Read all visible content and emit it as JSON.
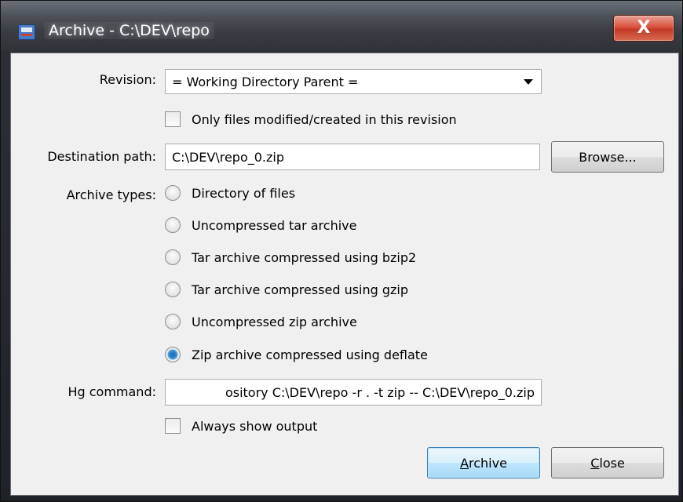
{
  "window": {
    "title": "Archive - C:\\DEV\\repo",
    "close_glyph": "X"
  },
  "form": {
    "revision_label": "Revision:",
    "revision_value": "= Working Directory Parent =",
    "only_modified_label": "Only files modified/created in this revision",
    "only_modified_checked": false,
    "destination_label": "Destination path:",
    "destination_value": "C:\\DEV\\repo_0.zip",
    "browse_label": "Browse...",
    "archive_types_label": "Archive types:",
    "archive_types": [
      {
        "label": "Directory of files",
        "checked": false
      },
      {
        "label": "Uncompressed tar archive",
        "checked": false
      },
      {
        "label": "Tar archive compressed using bzip2",
        "checked": false
      },
      {
        "label": "Tar archive compressed using gzip",
        "checked": false
      },
      {
        "label": "Uncompressed zip archive",
        "checked": false
      },
      {
        "label": "Zip archive compressed using deflate",
        "checked": true
      }
    ],
    "hg_command_label": "Hg command:",
    "hg_command_value": "ository C:\\DEV\\repo -r . -t zip -- C:\\DEV\\repo_0.zip",
    "always_show_label": "Always show output",
    "always_show_checked": false
  },
  "buttons": {
    "archive_mnemonic": "A",
    "archive_rest": "rchive",
    "close_mnemonic": "C",
    "close_rest": "lose"
  }
}
